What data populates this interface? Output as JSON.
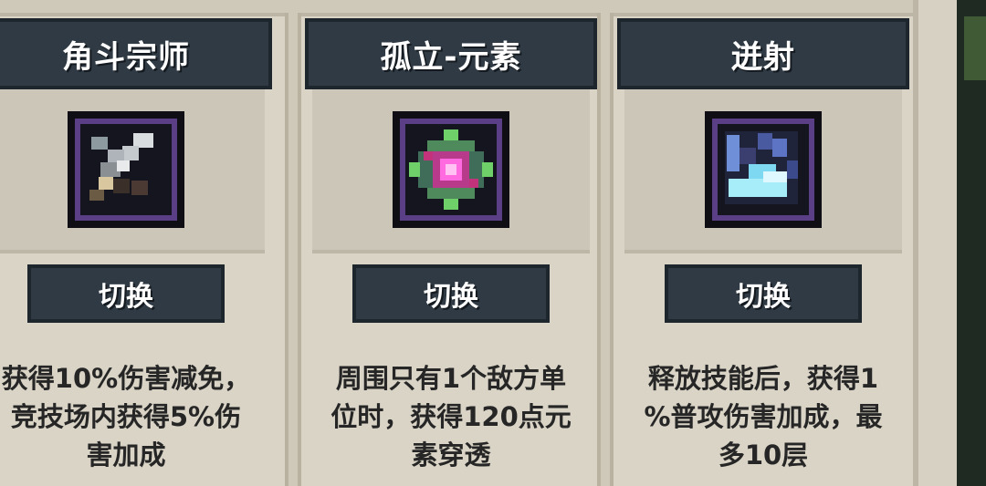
{
  "cards": [
    {
      "title": "角斗宗师",
      "icon": "crossed-swords-icon",
      "button_label": "切换",
      "desc_lines": [
        "获得10%伤害减免，",
        "竞技场内获得5%伤",
        "害加成"
      ]
    },
    {
      "title": "孤立-元素",
      "icon": "element-orb-icon",
      "button_label": "切换",
      "desc_lines": [
        "周围只有1个敌方单",
        "位时，获得120点元",
        "素穿透"
      ]
    },
    {
      "title": "迸射",
      "icon": "burst-wave-icon",
      "button_label": "切换",
      "desc_lines": [
        "释放技能后，获得1",
        "%普攻伤害加成，最",
        "多10层"
      ]
    }
  ],
  "colors": {
    "background": "#d9d4c6",
    "header": "#2f3a44",
    "frame_purple": "#5b3f86",
    "text_dark": "#262626"
  }
}
